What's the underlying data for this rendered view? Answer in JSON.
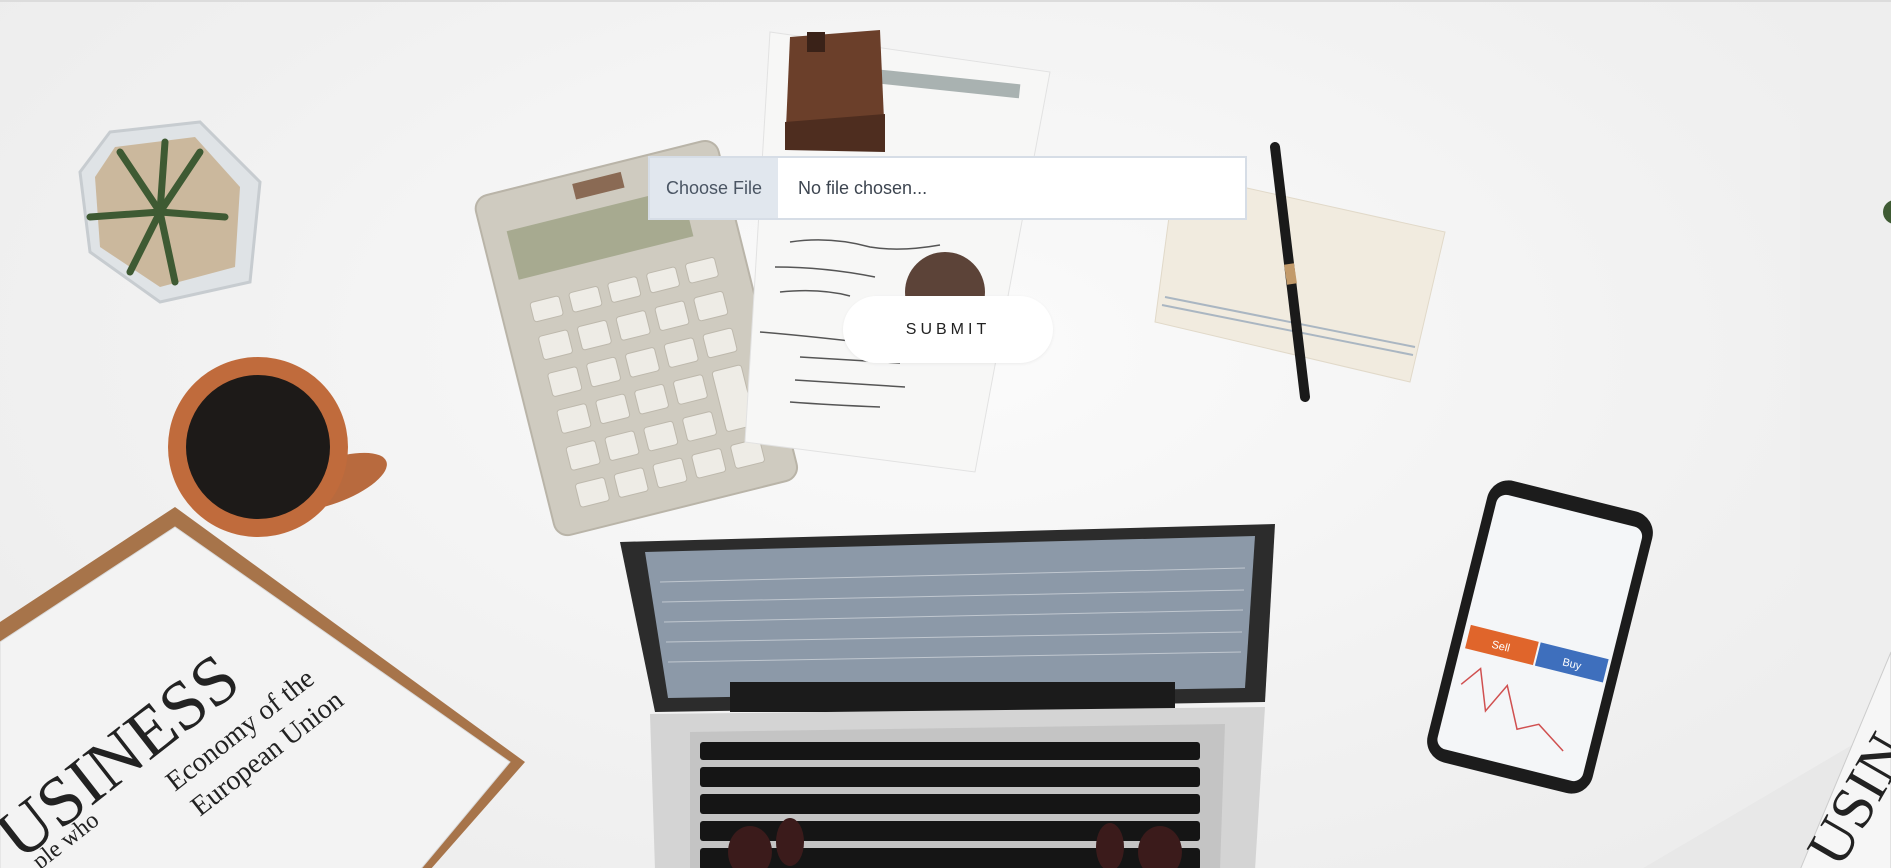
{
  "upload_form": {
    "choose_file_label": "Choose File",
    "file_status": "No file chosen...",
    "submit_label": "SUBMIT"
  },
  "background_photo": {
    "newspaper_masthead": "USINESS",
    "newspaper_headline_line1": "Economy of the",
    "newspaper_headline_line2": "European Union",
    "newspaper_fragment": "ple who",
    "right_newspaper_masthead": "USIN",
    "phone_sell_label": "Sell",
    "phone_buy_label": "Buy"
  },
  "colors": {
    "file_button_bg": "#e1e7ee",
    "submit_bg": "#ffffff",
    "page_bg": "#f2f2f2"
  }
}
